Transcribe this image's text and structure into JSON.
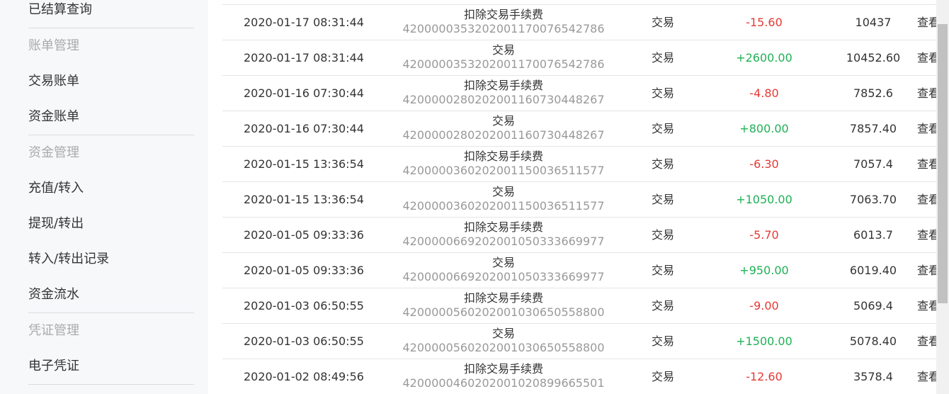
{
  "sidebar": {
    "items": [
      {
        "label": "已结算查询",
        "kind": "link"
      },
      {
        "label": "账单管理",
        "kind": "group"
      },
      {
        "label": "交易账单",
        "kind": "link"
      },
      {
        "label": "资金账单",
        "kind": "link"
      },
      {
        "label": "资金管理",
        "kind": "group"
      },
      {
        "label": "充值/转入",
        "kind": "link"
      },
      {
        "label": "提现/转出",
        "kind": "link"
      },
      {
        "label": "转入/转出记录",
        "kind": "link"
      },
      {
        "label": "资金流水",
        "kind": "link"
      },
      {
        "label": "凭证管理",
        "kind": "group"
      },
      {
        "label": "电子凭证",
        "kind": "link"
      }
    ]
  },
  "table": {
    "action_label": "查看",
    "rows": [
      {
        "time": "2020-01-17 08:31:44",
        "title": "扣除交易手续费",
        "no": "4200000353202001170076542786",
        "type": "交易",
        "amount": "-15.60",
        "sign": "neg",
        "balance": "10437"
      },
      {
        "time": "2020-01-17 08:31:44",
        "title": "交易",
        "no": "4200000353202001170076542786",
        "type": "交易",
        "amount": "+2600.00",
        "sign": "pos",
        "balance": "10452.60"
      },
      {
        "time": "2020-01-16 07:30:44",
        "title": "扣除交易手续费",
        "no": "4200000280202001160730448267",
        "type": "交易",
        "amount": "-4.80",
        "sign": "neg",
        "balance": "7852.6"
      },
      {
        "time": "2020-01-16 07:30:44",
        "title": "交易",
        "no": "4200000280202001160730448267",
        "type": "交易",
        "amount": "+800.00",
        "sign": "pos",
        "balance": "7857.40"
      },
      {
        "time": "2020-01-15 13:36:54",
        "title": "扣除交易手续费",
        "no": "4200000360202001150036511577",
        "type": "交易",
        "amount": "-6.30",
        "sign": "neg",
        "balance": "7057.4"
      },
      {
        "time": "2020-01-15 13:36:54",
        "title": "交易",
        "no": "4200000360202001150036511577",
        "type": "交易",
        "amount": "+1050.00",
        "sign": "pos",
        "balance": "7063.70"
      },
      {
        "time": "2020-01-05 09:33:36",
        "title": "扣除交易手续费",
        "no": "4200000669202001050333669977",
        "type": "交易",
        "amount": "-5.70",
        "sign": "neg",
        "balance": "6013.7"
      },
      {
        "time": "2020-01-05 09:33:36",
        "title": "交易",
        "no": "4200000669202001050333669977",
        "type": "交易",
        "amount": "+950.00",
        "sign": "pos",
        "balance": "6019.40"
      },
      {
        "time": "2020-01-03 06:50:55",
        "title": "扣除交易手续费",
        "no": "4200000560202001030650558800",
        "type": "交易",
        "amount": "-9.00",
        "sign": "neg",
        "balance": "5069.4"
      },
      {
        "time": "2020-01-03 06:50:55",
        "title": "交易",
        "no": "4200000560202001030650558800",
        "type": "交易",
        "amount": "+1500.00",
        "sign": "pos",
        "balance": "5078.40"
      },
      {
        "time": "2020-01-02 08:49:56",
        "title": "扣除交易手续费",
        "no": "4200000460202001020899665501",
        "type": "交易",
        "amount": "-12.60",
        "sign": "neg",
        "balance": "3578.4"
      }
    ]
  },
  "colors": {
    "negative": "#e53935",
    "positive": "#1fb155",
    "muted": "#999999",
    "group_label": "#aaaaaa",
    "sidebar_bg": "#f7f8fa"
  }
}
